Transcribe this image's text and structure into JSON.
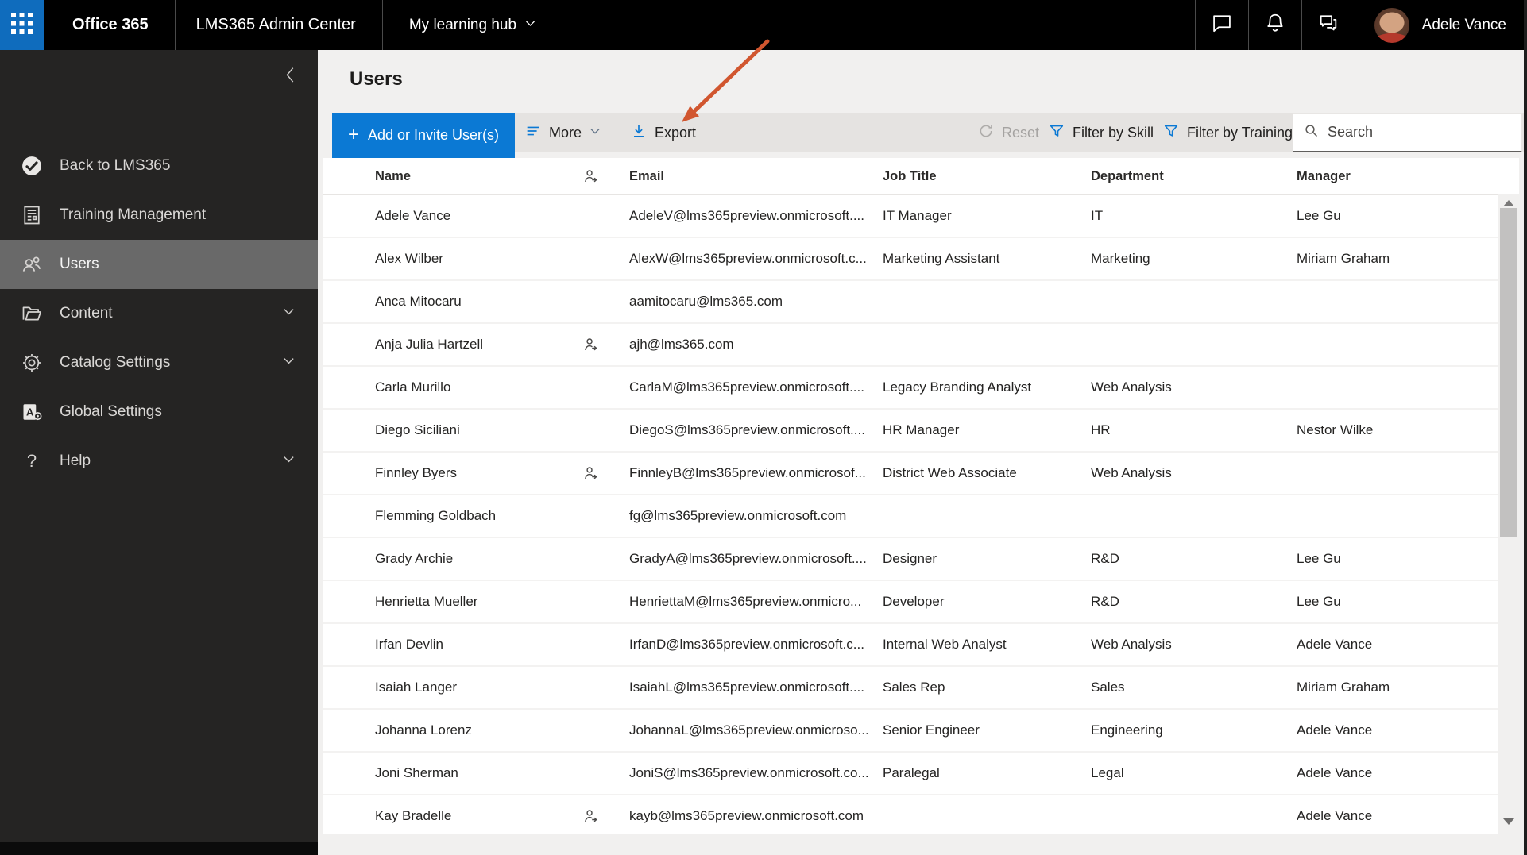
{
  "topbar": {
    "brand": "Office 365",
    "admin_center": "LMS365 Admin Center",
    "hub_menu": "My learning hub",
    "user_name": "Adele Vance"
  },
  "sidebar": {
    "items": [
      {
        "label": "Back to LMS365",
        "icon": "lms365-logo",
        "selected": false,
        "expandable": false
      },
      {
        "label": "Training Management",
        "icon": "document",
        "selected": false,
        "expandable": false
      },
      {
        "label": "Users",
        "icon": "people",
        "selected": true,
        "expandable": false
      },
      {
        "label": "Content",
        "icon": "folder",
        "selected": false,
        "expandable": true
      },
      {
        "label": "Catalog Settings",
        "icon": "gear",
        "selected": false,
        "expandable": true
      },
      {
        "label": "Global Settings",
        "icon": "global-settings",
        "selected": false,
        "expandable": false
      },
      {
        "label": "Help",
        "icon": "help",
        "selected": false,
        "expandable": true
      }
    ]
  },
  "page": {
    "title": "Users",
    "toolbar": {
      "add_button": "Add or Invite User(s)",
      "more": "More",
      "export": "Export",
      "reset": "Reset",
      "filter_skill": "Filter by Skill",
      "filter_training": "Filter by Training",
      "search_placeholder": "Search"
    }
  },
  "table": {
    "columns": [
      "Name",
      "Email",
      "Job Title",
      "Department",
      "Manager"
    ],
    "rows": [
      {
        "name": "Adele Vance",
        "guest": false,
        "email": "AdeleV@lms365preview.onmicrosoft....",
        "job": "IT Manager",
        "dept": "IT",
        "manager": "Lee Gu"
      },
      {
        "name": "Alex Wilber",
        "guest": false,
        "email": "AlexW@lms365preview.onmicrosoft.c...",
        "job": "Marketing Assistant",
        "dept": "Marketing",
        "manager": "Miriam Graham"
      },
      {
        "name": "Anca Mitocaru",
        "guest": false,
        "email": "aamitocaru@lms365.com",
        "job": "",
        "dept": "",
        "manager": ""
      },
      {
        "name": "Anja Julia Hartzell",
        "guest": true,
        "email": "ajh@lms365.com",
        "job": "",
        "dept": "",
        "manager": ""
      },
      {
        "name": "Carla Murillo",
        "guest": false,
        "email": "CarlaM@lms365preview.onmicrosoft....",
        "job": "Legacy Branding Analyst",
        "dept": "Web Analysis",
        "manager": ""
      },
      {
        "name": "Diego Siciliani",
        "guest": false,
        "email": "DiegoS@lms365preview.onmicrosoft....",
        "job": "HR Manager",
        "dept": "HR",
        "manager": "Nestor Wilke"
      },
      {
        "name": "Finnley Byers",
        "guest": true,
        "email": "FinnleyB@lms365preview.onmicrosof...",
        "job": "District Web Associate",
        "dept": "Web Analysis",
        "manager": ""
      },
      {
        "name": "Flemming Goldbach",
        "guest": false,
        "email": "fg@lms365preview.onmicrosoft.com",
        "job": "",
        "dept": "",
        "manager": ""
      },
      {
        "name": "Grady Archie",
        "guest": false,
        "email": "GradyA@lms365preview.onmicrosoft....",
        "job": "Designer",
        "dept": "R&D",
        "manager": "Lee Gu"
      },
      {
        "name": "Henrietta Mueller",
        "guest": false,
        "email": "HenriettaM@lms365preview.onmicro...",
        "job": "Developer",
        "dept": "R&D",
        "manager": "Lee Gu"
      },
      {
        "name": "Irfan Devlin",
        "guest": false,
        "email": "IrfanD@lms365preview.onmicrosoft.c...",
        "job": "Internal Web Analyst",
        "dept": "Web Analysis",
        "manager": "Adele Vance"
      },
      {
        "name": "Isaiah Langer",
        "guest": false,
        "email": "IsaiahL@lms365preview.onmicrosoft....",
        "job": "Sales Rep",
        "dept": "Sales",
        "manager": "Miriam Graham"
      },
      {
        "name": "Johanna Lorenz",
        "guest": false,
        "email": "JohannaL@lms365preview.onmicroso...",
        "job": "Senior Engineer",
        "dept": "Engineering",
        "manager": "Adele Vance"
      },
      {
        "name": "Joni Sherman",
        "guest": false,
        "email": "JoniS@lms365preview.onmicrosoft.co...",
        "job": "Paralegal",
        "dept": "Legal",
        "manager": "Adele Vance"
      },
      {
        "name": "Kay Bradelle",
        "guest": true,
        "email": "kayb@lms365preview.onmicrosoft.com",
        "job": "",
        "dept": "",
        "manager": "Adele Vance"
      }
    ]
  },
  "annotation": {
    "type": "arrow",
    "points_to": "Export",
    "color": "#d1562f"
  },
  "colors": {
    "accent_blue": "#0b79d4",
    "waffle_blue": "#0f6cbd",
    "topbar_bg": "#000000",
    "sidebar_bg": "#252423",
    "sidebar_selected": "#696969",
    "toolbar_bg": "#e5e3e1",
    "page_bg": "#f1f0ef",
    "icon_blue": "#106ebe",
    "annotation_arrow": "#d1562f"
  }
}
